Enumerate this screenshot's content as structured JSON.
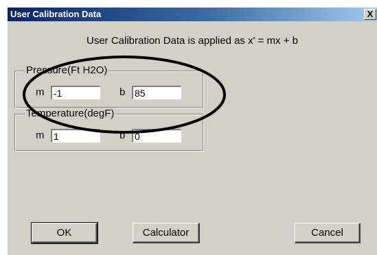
{
  "window": {
    "title": "User Calibration Data",
    "close_symbol": "X"
  },
  "formula_text": "User Calibration Data is applied as x' = mx + b",
  "pressure": {
    "legend": "Pressure(Ft H2O)",
    "m_label": "m",
    "m_value": "-1",
    "b_label": "b",
    "b_value": "85"
  },
  "temperature": {
    "legend": "Temperature(degF)",
    "m_label": "m",
    "m_value": "1",
    "b_label": "b",
    "b_value": "0"
  },
  "buttons": {
    "ok": "OK",
    "calculator": "Calculator",
    "cancel": "Cancel"
  },
  "colors": {
    "dialog_bg": "#d4d0c8",
    "titlebar_start": "#0a246a",
    "titlebar_end": "#a6caf0",
    "annotation_ellipse": "#000000"
  }
}
